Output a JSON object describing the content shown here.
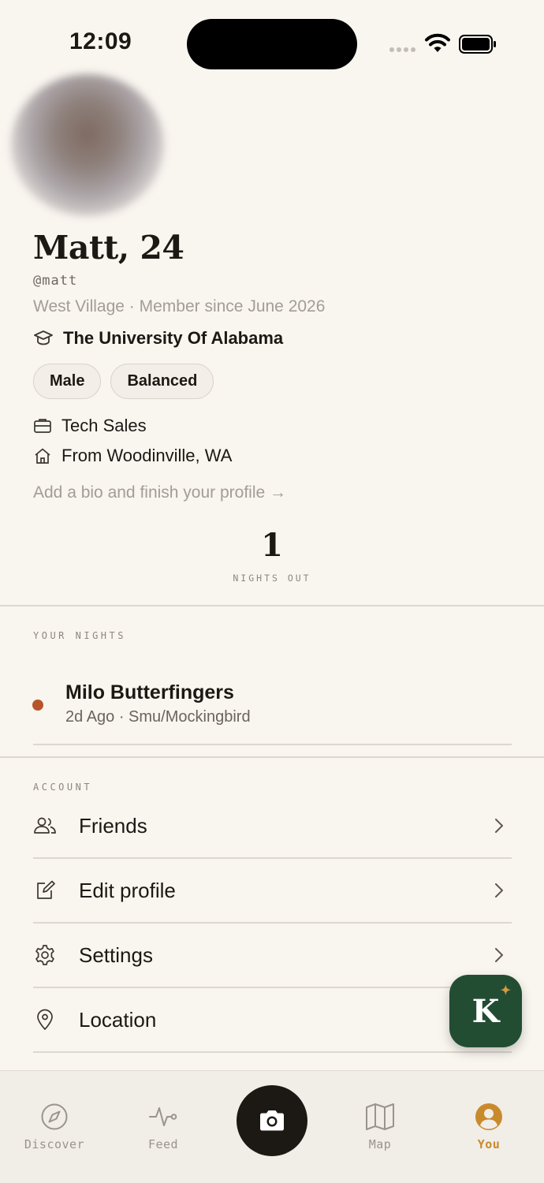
{
  "status_bar": {
    "time": "12:09"
  },
  "profile": {
    "name_age": "Matt, 24",
    "handle": "@matt",
    "meta": "West Village · Member since June 2026",
    "university": "The University Of Alabama",
    "tags": [
      "Male",
      "Balanced"
    ],
    "job": "Tech Sales",
    "hometown": "From Woodinville, WA",
    "bio_prompt": "Add a bio and finish your profile →"
  },
  "stats": {
    "nights_out_value": "1",
    "nights_out_label": "NIGHTS OUT"
  },
  "your_nights": {
    "section_label": "YOUR NIGHTS",
    "items": [
      {
        "title": "Milo Butterfingers",
        "subtitle": "2d Ago · Smu/Mockingbird",
        "dot_color": "#b8542a"
      }
    ]
  },
  "account": {
    "section_label": "ACCOUNT",
    "items": [
      {
        "label": "Friends",
        "icon": "friends-icon"
      },
      {
        "label": "Edit profile",
        "icon": "edit-icon"
      },
      {
        "label": "Settings",
        "icon": "gear-icon"
      },
      {
        "label": "Location",
        "icon": "location-pin-icon"
      }
    ]
  },
  "fab": {
    "letter": "K",
    "color": "#234d33",
    "spark": "✦"
  },
  "tabbar": {
    "tabs": [
      {
        "label": "Discover",
        "icon": "compass-icon"
      },
      {
        "label": "Feed",
        "icon": "pulse-icon"
      },
      {
        "label": "Map",
        "icon": "map-icon"
      },
      {
        "label": "You",
        "icon": "user-icon",
        "active": true
      }
    ],
    "camera_icon": "camera-icon",
    "accent": "#c98a2c"
  }
}
